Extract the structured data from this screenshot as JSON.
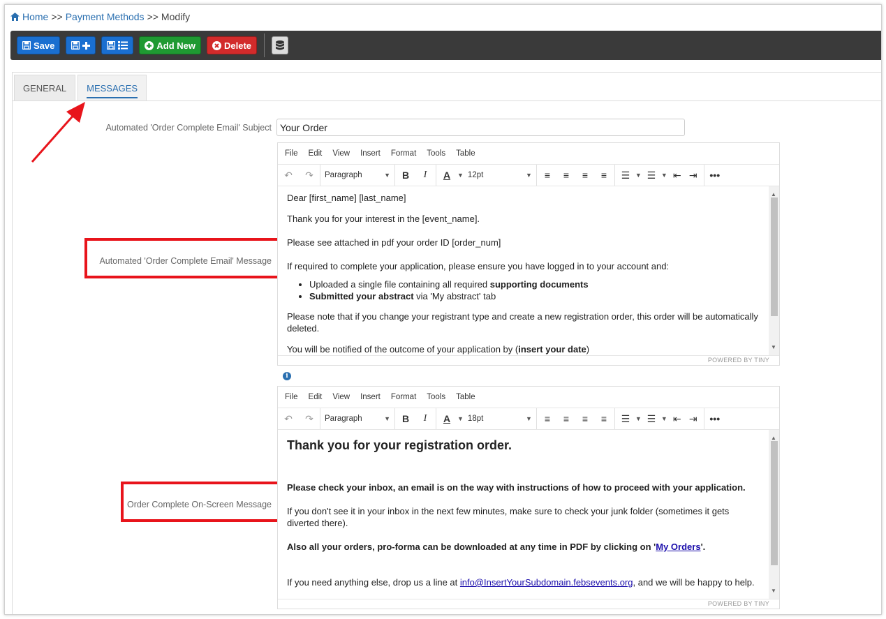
{
  "breadcrumb": {
    "home": "Home",
    "sep1": ">>",
    "payment_methods": "Payment Methods",
    "sep2": ">>",
    "current": "Modify"
  },
  "toolbar": {
    "save": "Save",
    "add_new": "Add New",
    "delete": "Delete"
  },
  "tabs": [
    {
      "label": "GENERAL"
    },
    {
      "label": "MESSAGES"
    }
  ],
  "fields": {
    "subject_label": "Automated 'Order Complete Email' Subject",
    "subject_value": "Your Order",
    "message_label": "Automated 'Order Complete Email' Message",
    "onscreen_label": "Order Complete On-Screen Message"
  },
  "editor_menu": [
    "File",
    "Edit",
    "View",
    "Insert",
    "Format",
    "Tools",
    "Table"
  ],
  "editor1": {
    "block_format": "Paragraph",
    "font_size": "12pt",
    "status": "POWERED BY TINY",
    "p1": "Dear [first_name] [last_name]",
    "p2": "Thank you for your interest in the [event_name].",
    "p3": "Please see attached in pdf your order ID [order_num]",
    "p4": "If required to complete your application, please ensure you have logged in to your account and:",
    "li1_a": "Uploaded a single file containing all required ",
    "li1_b": "supporting documents",
    "li2_a": "Submitted your abstract",
    "li2_b": " via 'My abstract' tab",
    "p5": "Please note that if you change your registrant type and create a new registration order, this order will be automatically deleted.",
    "p6_a": "You will be notified of the outcome of your application by (",
    "p6_b": "insert your date",
    "p6_c": ")"
  },
  "editor2": {
    "block_format": "Paragraph",
    "font_size": "18pt",
    "status": "POWERED BY TINY",
    "h1": "Thank you for your registration order.",
    "p1": "Please check your inbox, an email is on the way with instructions of how to proceed with your application.",
    "p2": "If you don't see it in your inbox in the next few minutes, make sure to check your junk folder (sometimes it gets diverted there).",
    "p3_a": "Also all your orders, pro-forma can be downloaded at any time in PDF by clicking on '",
    "p3_link": "My Orders",
    "p3_b": "'.",
    "p4_a": "If you need anything else, drop us a line at ",
    "p4_link": "info@InsertYourSubdomain.febsevents.org",
    "p4_b": ", and we will be happy to help."
  },
  "colors": {
    "annotation_red": "#e8141b",
    "link_blue": "#2a6fb0",
    "toolbar_dark": "#3a3a3a"
  }
}
